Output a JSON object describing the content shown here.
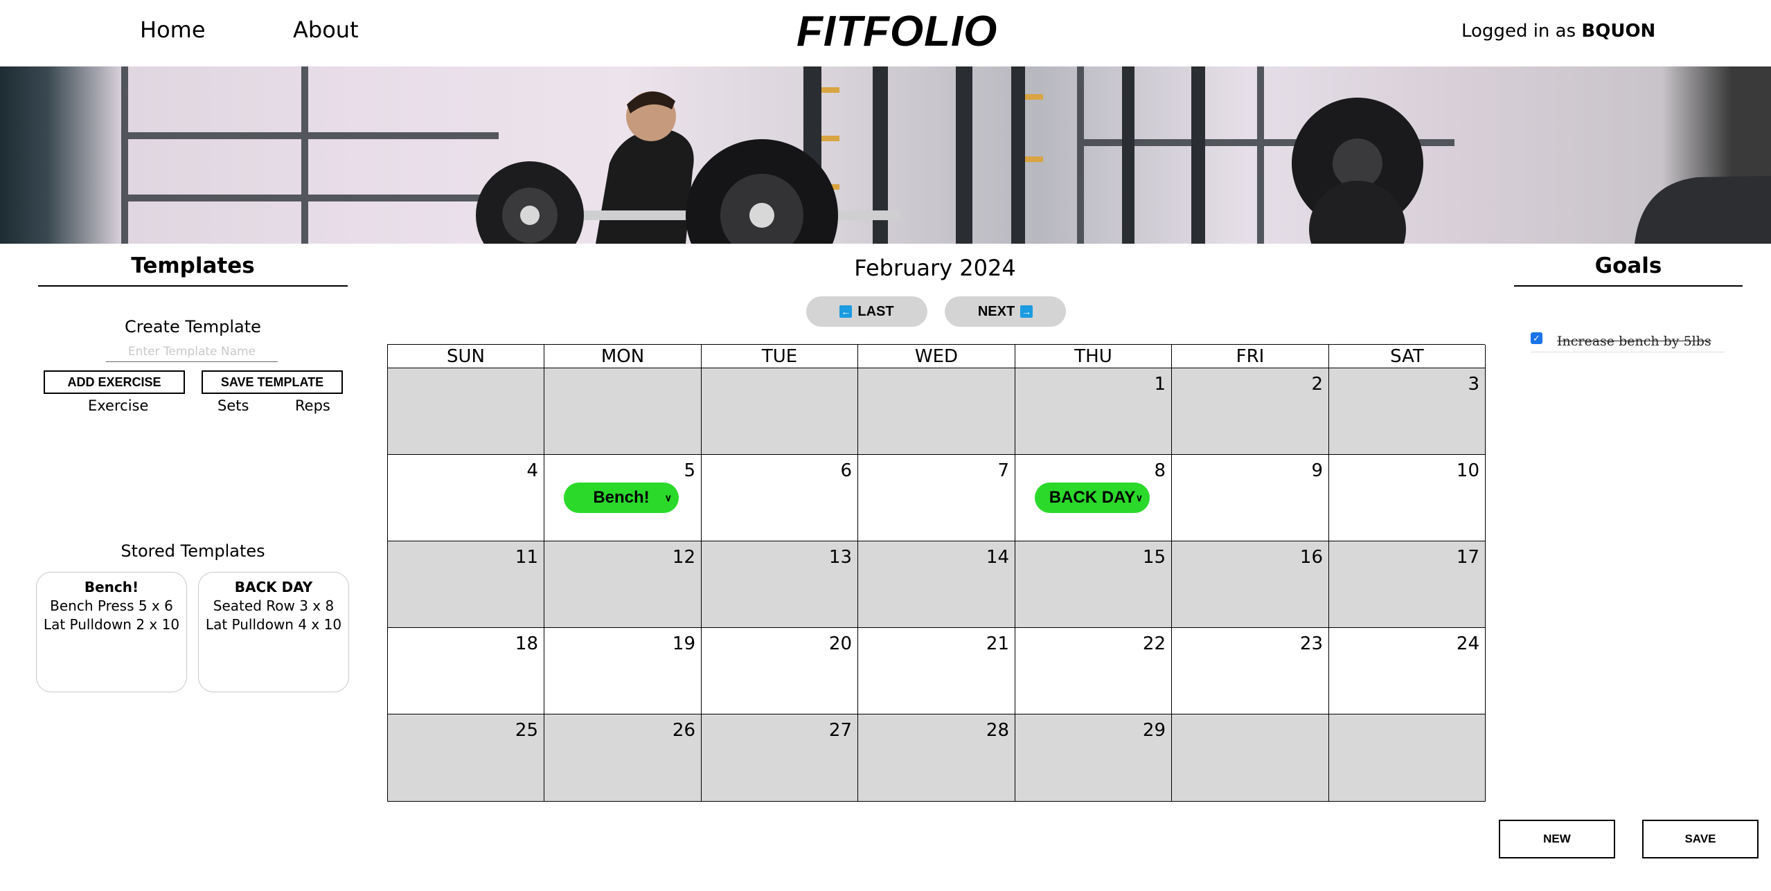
{
  "nav": {
    "home": "Home",
    "about": "About",
    "brand": "FITFOLIO",
    "login_prefix": "Logged in as ",
    "username": "BQUON"
  },
  "hero": {
    "image": "gym-barbell-photo"
  },
  "templates": {
    "title": "Templates",
    "create_title": "Create Template",
    "name_placeholder": "Enter Template Name",
    "add_exercise": "ADD EXERCISE",
    "save_template": "SAVE TEMPLATE",
    "columns": [
      "Exercise",
      "Sets",
      "Reps"
    ],
    "stored_title": "Stored Templates",
    "stored": [
      {
        "name": "Bench!",
        "lines": [
          "Bench Press 5 x 6",
          "Lat Pulldown 2 x 10"
        ]
      },
      {
        "name": "BACK DAY",
        "lines": [
          "Seated Row 3 x 8",
          "Lat Pulldown 4 x 10"
        ]
      }
    ]
  },
  "calendar": {
    "month": "February 2024",
    "last": "LAST",
    "next": "NEXT",
    "days": [
      "SUN",
      "MON",
      "TUE",
      "WED",
      "THU",
      "FRI",
      "SAT"
    ],
    "weeks": [
      [
        "",
        "",
        "",
        "",
        "1",
        "2",
        "3"
      ],
      [
        "4",
        "5",
        "6",
        "7",
        "8",
        "9",
        "10"
      ],
      [
        "11",
        "12",
        "13",
        "14",
        "15",
        "16",
        "17"
      ],
      [
        "18",
        "19",
        "20",
        "21",
        "22",
        "23",
        "24"
      ],
      [
        "25",
        "26",
        "27",
        "28",
        "29",
        "",
        ""
      ]
    ],
    "events": [
      {
        "week": 1,
        "day": 1,
        "label": "Bench!"
      },
      {
        "week": 1,
        "day": 4,
        "label": "BACK DAY"
      }
    ]
  },
  "goals": {
    "title": "Goals",
    "items": [
      {
        "text": "Increase bench by 5lbs",
        "done": true
      }
    ],
    "new": "NEW",
    "save": "SAVE"
  },
  "colors": {
    "event_green": "#2bd92b",
    "shaded_cell": "#d8d8d8",
    "pill_gray": "#d4d4d4",
    "arrow_blue": "#1b9be0"
  }
}
